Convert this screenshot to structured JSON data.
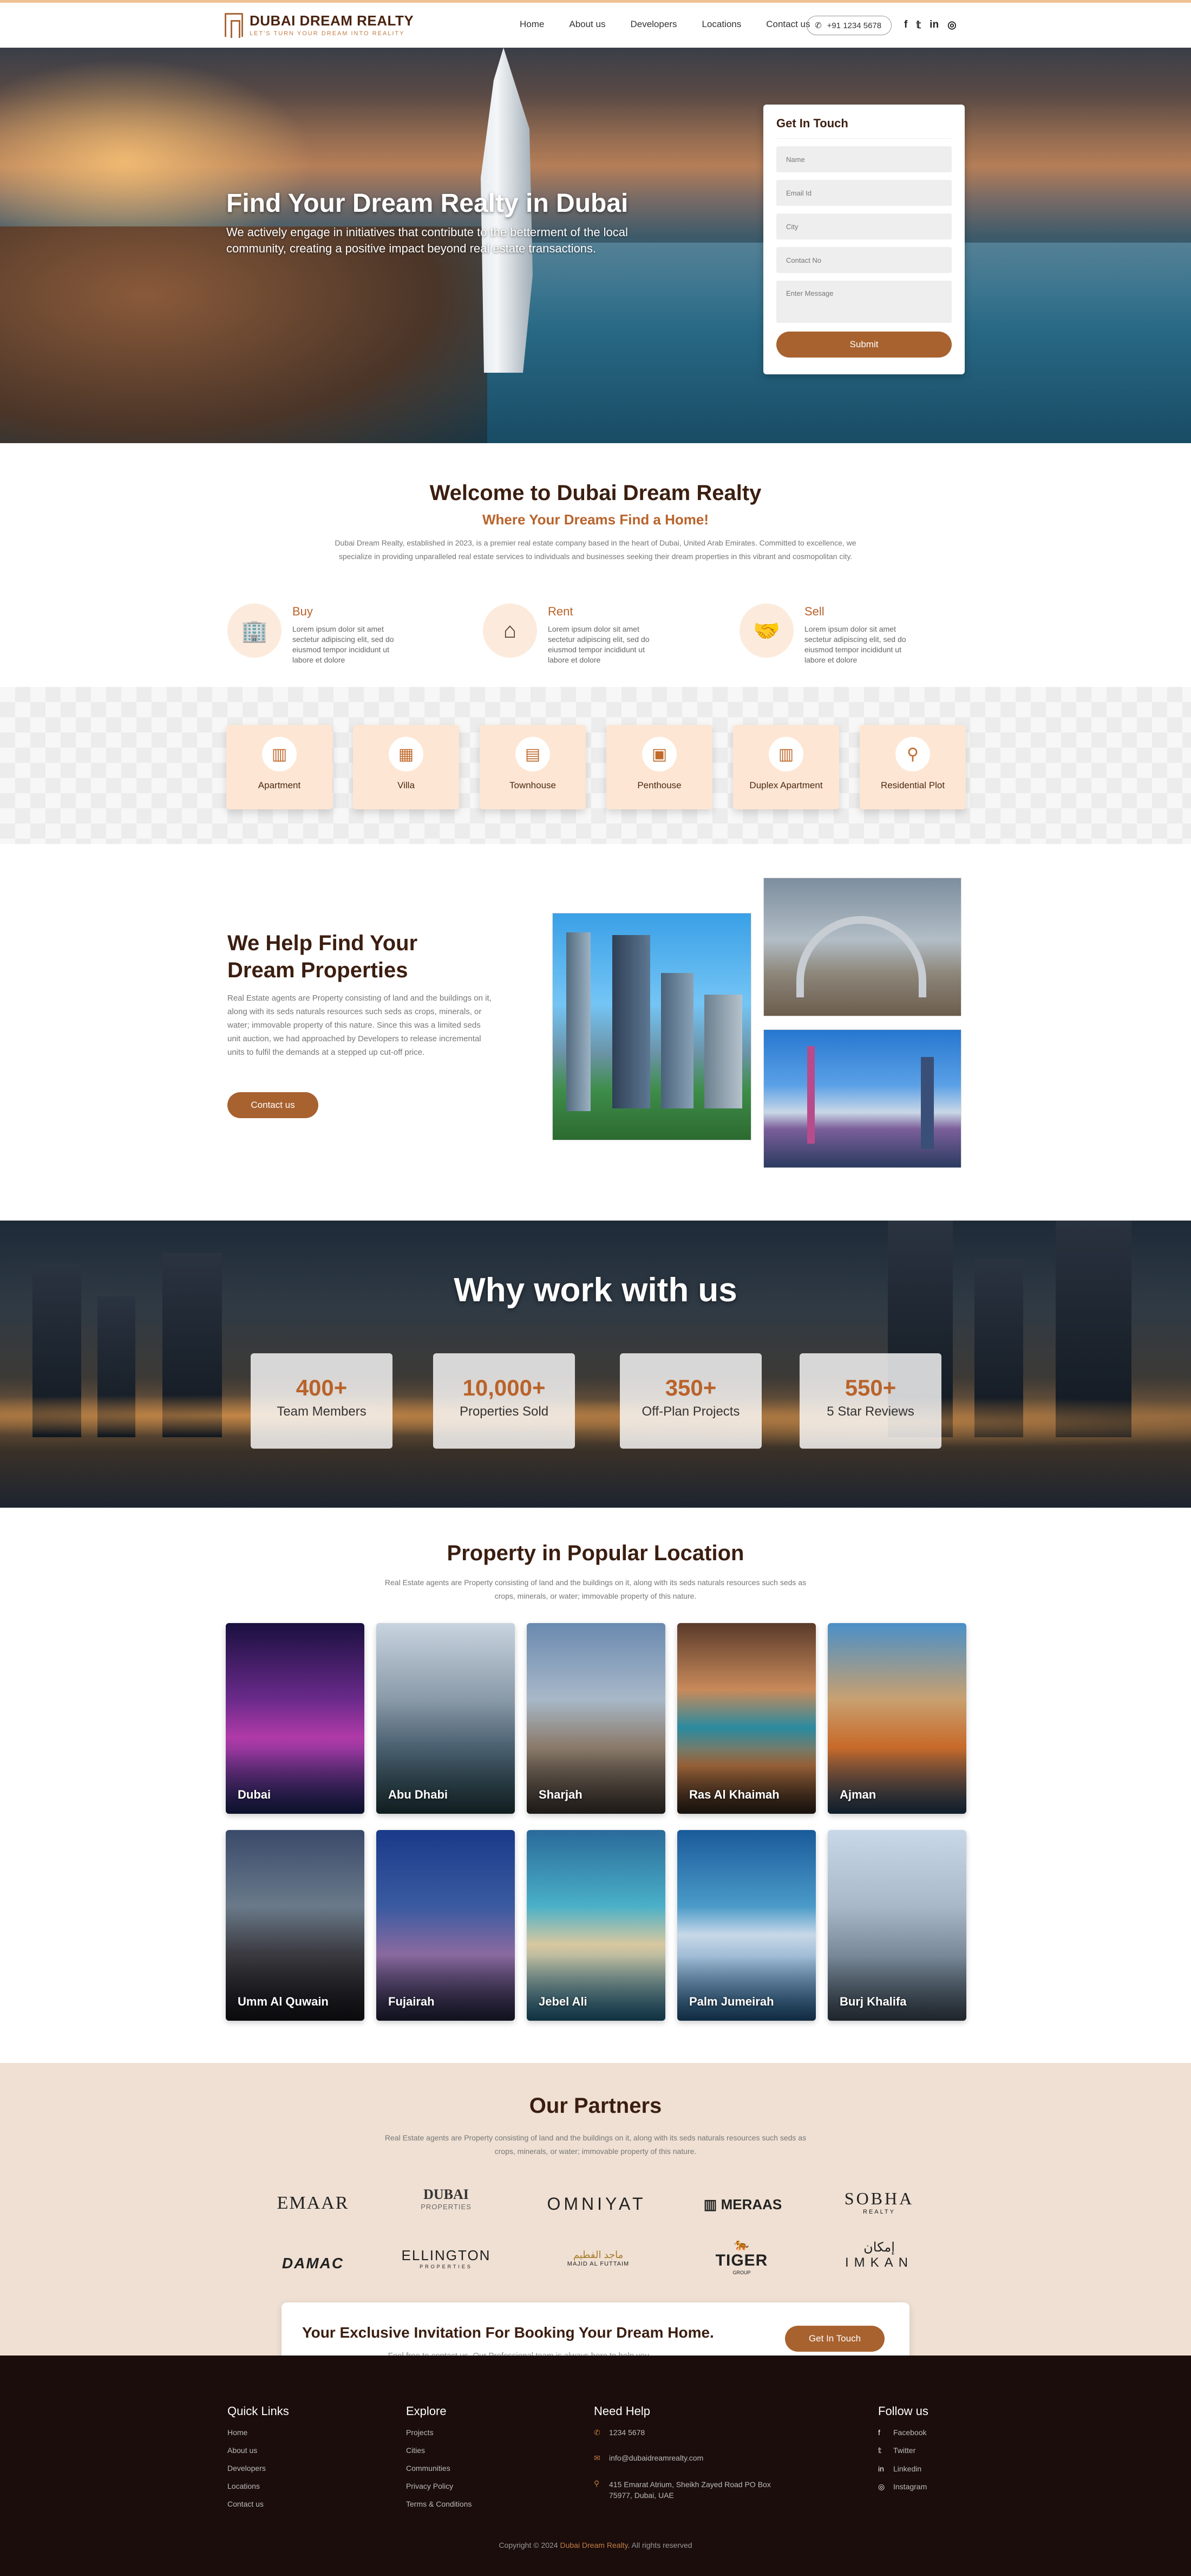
{
  "header": {
    "brand": "DUBAI DREAM REALTY",
    "tagline": "LET'S TURN YOUR DREAM INTO REALITY",
    "nav": [
      "Home",
      "About us",
      "Developers",
      "Locations",
      "Contact us"
    ],
    "phone": "+91 1234 5678",
    "social_icons": [
      "facebook-icon",
      "twitter-icon",
      "linkedin-icon",
      "instagram-icon"
    ]
  },
  "hero": {
    "title": "Find Your Dream Realty in Dubai",
    "subtitle": "We actively engage in initiatives that contribute to the betterment of the local community, creating a positive impact beyond real estate transactions.",
    "form": {
      "title": "Get In Touch",
      "fields": [
        "Name",
        "Email Id",
        "City",
        "Contact No"
      ],
      "message_placeholder": "Enter Message",
      "submit": "Submit"
    }
  },
  "welcome": {
    "title": "Welcome to Dubai Dream Realty",
    "subtitle": "Where Your Dreams Find a Home!",
    "description": "Dubai Dream Realty, established in 2023, is a premier real estate company based in the heart of Dubai, United Arab Emirates. Committed to excellence, we specialize in providing unparalleled real estate services to individuals and businesses seeking their dream properties in this vibrant and cosmopolitan city.",
    "services": [
      {
        "title": "Buy",
        "text": "Lorem ipsum dolor sit amet sectetur adipiscing elit, sed do eiusmod tempor incididunt ut labore et dolore"
      },
      {
        "title": "Rent",
        "text": "Lorem ipsum dolor sit amet sectetur adipiscing elit, sed do eiusmod tempor incididunt ut labore et dolore"
      },
      {
        "title": "Sell",
        "text": "Lorem ipsum dolor sit amet sectetur adipiscing elit, sed do eiusmod tempor incididunt ut labore et dolore"
      }
    ]
  },
  "property_types": [
    "Apartment",
    "Villa",
    "Townhouse",
    "Penthouse",
    "Duplex Apartment",
    "Residential Plot"
  ],
  "help": {
    "title": "We Help Find Your Dream Properties",
    "text": "Real Estate agents are Property consisting of land and the buildings on it, along with its seds naturals resources such seds as crops, minerals, or water; immovable property of this nature. Since this was a limited seds unit auction, we had approached by Developers to release incremental units to fulfil the demands at a stepped up cut-off price.",
    "button": "Contact us"
  },
  "why": {
    "title": "Why work with us",
    "stats": [
      {
        "number": "400+",
        "label": "Team Members"
      },
      {
        "number": "10,000+",
        "label": "Properties Sold"
      },
      {
        "number": "350+",
        "label": "Off-Plan Projects"
      },
      {
        "number": "550+",
        "label": "5 Star Reviews"
      }
    ]
  },
  "locations": {
    "title": "Property in Popular Location",
    "text": "Real Estate agents are Property consisting of land and the buildings on it, along with its seds naturals resources such seds as crops, minerals, or water; immovable property of this nature.",
    "items": [
      "Dubai",
      "Abu Dhabi",
      "Sharjah",
      "Ras Al Khaimah",
      "Ajman",
      "Umm Al Quwain",
      "Fujairah",
      "Jebel Ali",
      "Palm Jumeirah",
      "Burj Khalifa"
    ]
  },
  "partners": {
    "title": "Our Partners",
    "text": "Real Estate agents are Property consisting of land and the buildings on it, along with its seds naturals resources such seds as crops, minerals, or water; immovable property of this nature.",
    "logos": [
      "EMAAR",
      "DUBAI",
      "PROPERTIES",
      "OMNIYAT",
      "MERAAS",
      "SOBHA",
      "REALTY",
      "DAMAC",
      "ELLINGTON",
      "PROPERTIES",
      "MAJID AL FUTTAIM",
      "ماجد الفطيم",
      "TIGER",
      "GROUP",
      "IMKAN",
      "إمكان"
    ]
  },
  "cta": {
    "title": "Your Exclusive Invitation For Booking Your Dream Home.",
    "text": "Feel free to contact us, Our Professional team is always here to help you",
    "button": "Get In Touch"
  },
  "footer": {
    "quick_links": {
      "title": "Quick Links",
      "items": [
        "Home",
        "About us",
        "Developers",
        "Locations",
        "Contact us"
      ]
    },
    "explore": {
      "title": "Explore",
      "items": [
        "Projects",
        "Cities",
        "Communities",
        "Privacy Policy",
        "Terms & Conditions"
      ]
    },
    "help": {
      "title": "Need Help",
      "phone": "1234 5678",
      "email": "info@dubaidreamrealty.com",
      "address": "415 Emarat Atrium, Sheikh Zayed Road PO Box 75977, Dubai, UAE"
    },
    "follow": {
      "title": "Follow us",
      "items": [
        "Facebook",
        "Twitter",
        "Linkedin",
        "Instagram"
      ]
    },
    "copyright_prefix": "Copyright © 2024 ",
    "copyright_brand": "Dubai Dream Realty",
    "copyright_suffix": ". All rights reserved"
  },
  "colors": {
    "accent": "#a8622f",
    "heading": "#3b1e10",
    "footer_bg": "#1a0d0b",
    "partners_bg": "#efe0d3"
  }
}
